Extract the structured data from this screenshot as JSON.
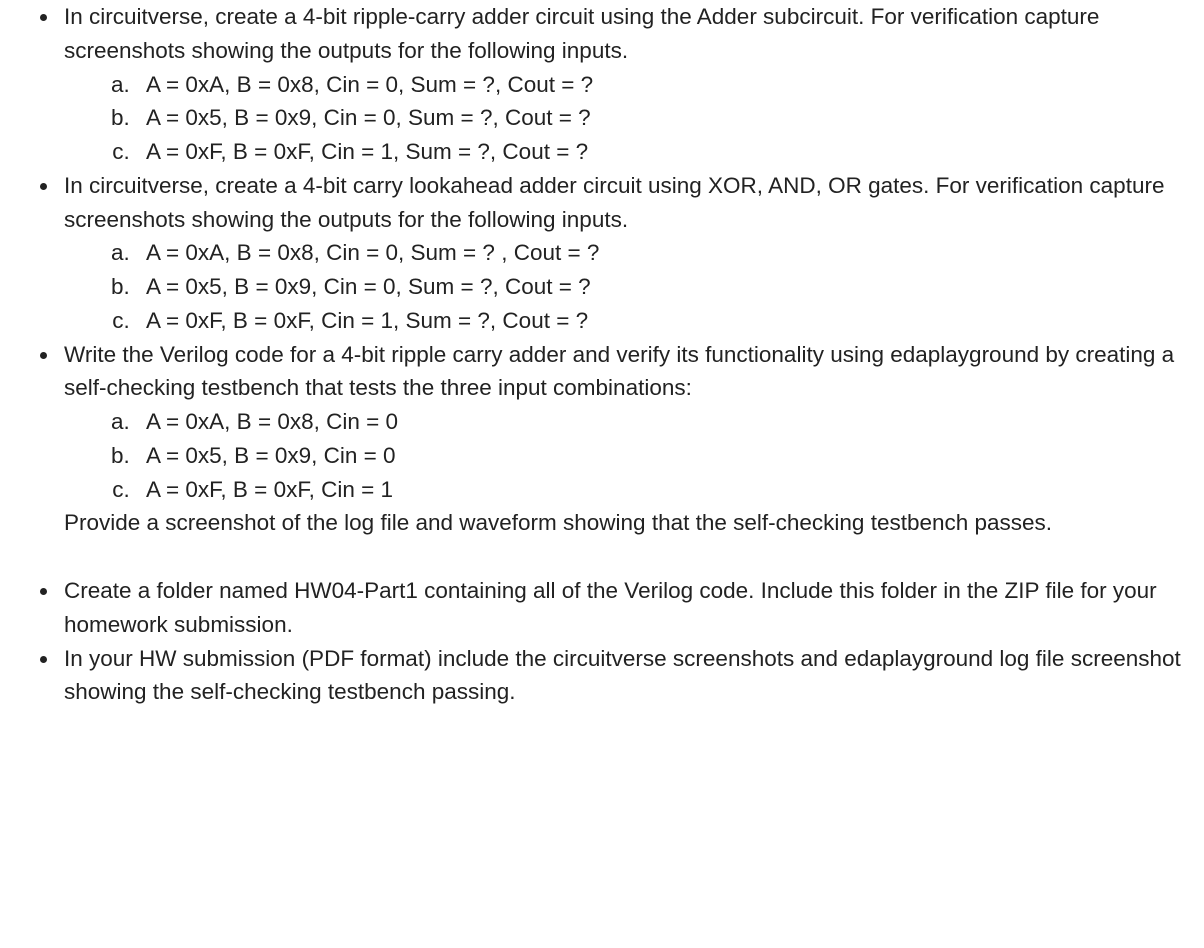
{
  "items": [
    {
      "text": "In circuitverse, create a 4-bit ripple-carry adder circuit using the Adder subcircuit. For verification capture screenshots showing the outputs for the following inputs.",
      "sub": [
        "A = 0xA, B = 0x8, Cin = 0, Sum = ?, Cout = ?",
        "A = 0x5, B = 0x9, Cin = 0, Sum = ?, Cout = ?",
        "A = 0xF, B = 0xF, Cin = 1, Sum = ?, Cout = ?"
      ]
    },
    {
      "text": "In circuitverse, create a 4-bit carry lookahead adder circuit using XOR, AND, OR gates. For verification capture screenshots showing the outputs for the following inputs.",
      "sub": [
        "A = 0xA, B = 0x8, Cin = 0, Sum = ? , Cout = ?",
        "A = 0x5, B = 0x9, Cin = 0, Sum = ?, Cout = ?",
        "A = 0xF, B = 0xF, Cin = 1, Sum = ?, Cout = ?"
      ]
    },
    {
      "text": "Write the Verilog code for a 4-bit ripple carry adder and verify its functionality using edaplayground by creating a self-checking testbench that tests the three input combinations:",
      "sub": [
        "A = 0xA, B = 0x8, Cin = 0",
        "A = 0x5, B = 0x9, Cin = 0",
        "A = 0xF, B = 0xF, Cin = 1"
      ],
      "trailing": "Provide a screenshot of the log file and waveform showing that the self-checking testbench passes."
    },
    {
      "gap_before": true,
      "text": "Create a folder named HW04-Part1 containing all of the Verilog code. Include this folder in the ZIP file for your homework submission."
    },
    {
      "text": "In your HW submission (PDF format) include the circuitverse screenshots and edaplayground log file screenshot showing the self-checking testbench passing."
    }
  ]
}
